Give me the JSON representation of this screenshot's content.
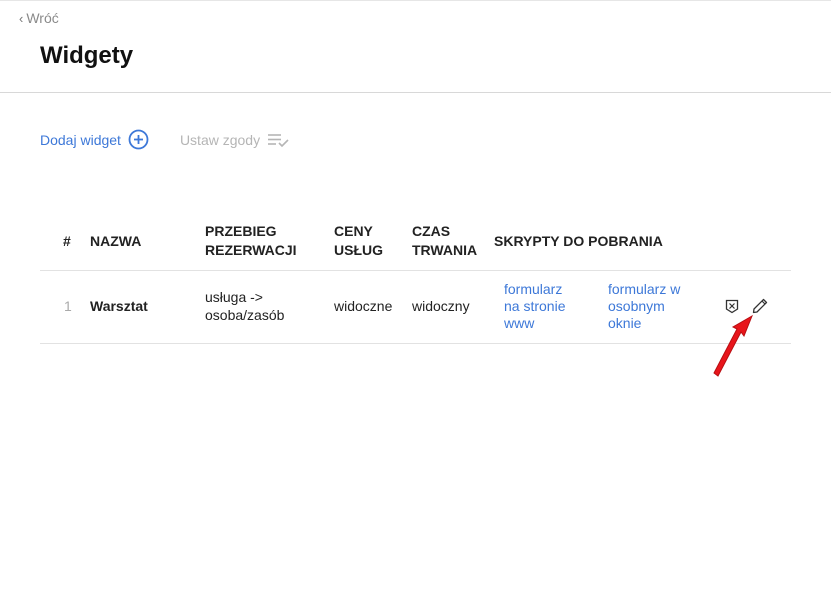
{
  "nav": {
    "back_label": "Wróć"
  },
  "page": {
    "title": "Widgety"
  },
  "actions": {
    "add_label": "Dodaj widget",
    "consent_label": "Ustaw zgody"
  },
  "table": {
    "headers": {
      "num": "#",
      "name": "NAZWA",
      "flow_1": "PRZEBIEG",
      "flow_2": "REZERWACJI",
      "prices_1": "CENY",
      "prices_2": "USŁUG",
      "duration_1": "CZAS",
      "duration_2": "TRWANIA",
      "scripts": "SKRYPTY DO POBRANIA"
    },
    "rows": [
      {
        "num": "1",
        "name": "Warsztat",
        "flow_1": "usługa ->",
        "flow_2": "osoba/zasób",
        "prices": "widoczne",
        "duration": "widoczny",
        "script_www_1": "formularz",
        "script_www_2": "na stronie",
        "script_www_3": "www",
        "script_window_1": "formularz w",
        "script_window_2": "osobnym",
        "script_window_3": "oknie",
        "delete_icon": "delete-box-icon",
        "edit_icon": "pencil-icon"
      }
    ]
  },
  "colors": {
    "accent": "#3d78d8",
    "muted": "#b5b5b5",
    "annotation_arrow": "#e8151b"
  }
}
